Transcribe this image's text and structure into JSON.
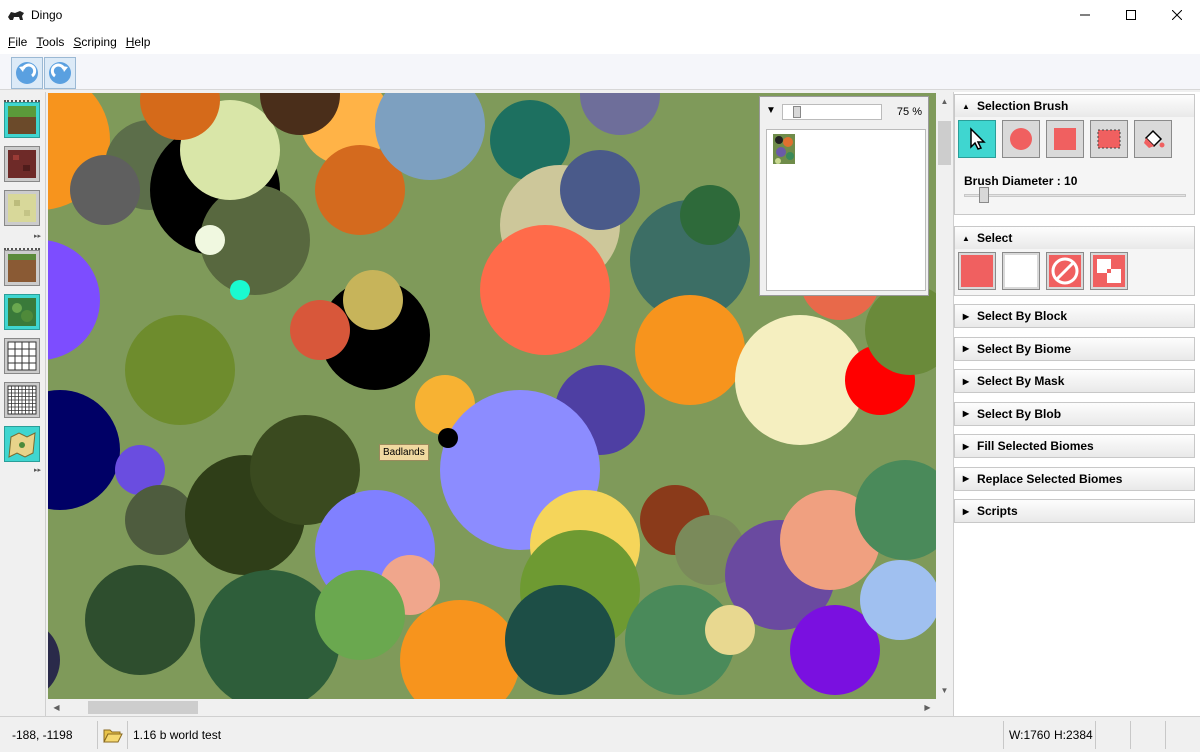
{
  "window": {
    "title": "Dingo",
    "minimize_icon": "minimize-icon",
    "maximize_icon": "maximize-icon",
    "close_icon": "close-icon"
  },
  "menu": [
    "File",
    "Tools",
    "Scriping",
    "Help"
  ],
  "toolbar": {
    "undo_icon": "undo-icon",
    "redo_icon": "redo-icon"
  },
  "minimap": {
    "zoom": "75 %"
  },
  "canvas": {
    "tooltip": "Badlands"
  },
  "panel": {
    "selection_brush": {
      "title": "Selection Brush",
      "diameter_label": "Brush Diameter : 10",
      "diameter_value": 10
    },
    "select": {
      "title": "Select"
    },
    "collapsed_sections": [
      "Select By Block",
      "Select By Biome",
      "Select By Mask",
      "Select By Blob",
      "Fill Selected Biomes",
      "Replace Selected Biomes",
      "Scripts"
    ]
  },
  "status": {
    "coords": "-188, -1198",
    "world": "1.16 b world test",
    "width": "W:1760",
    "height": "H:2384"
  },
  "colors": {
    "accent": "#3fd6d0",
    "brush_red": "#f06060"
  }
}
